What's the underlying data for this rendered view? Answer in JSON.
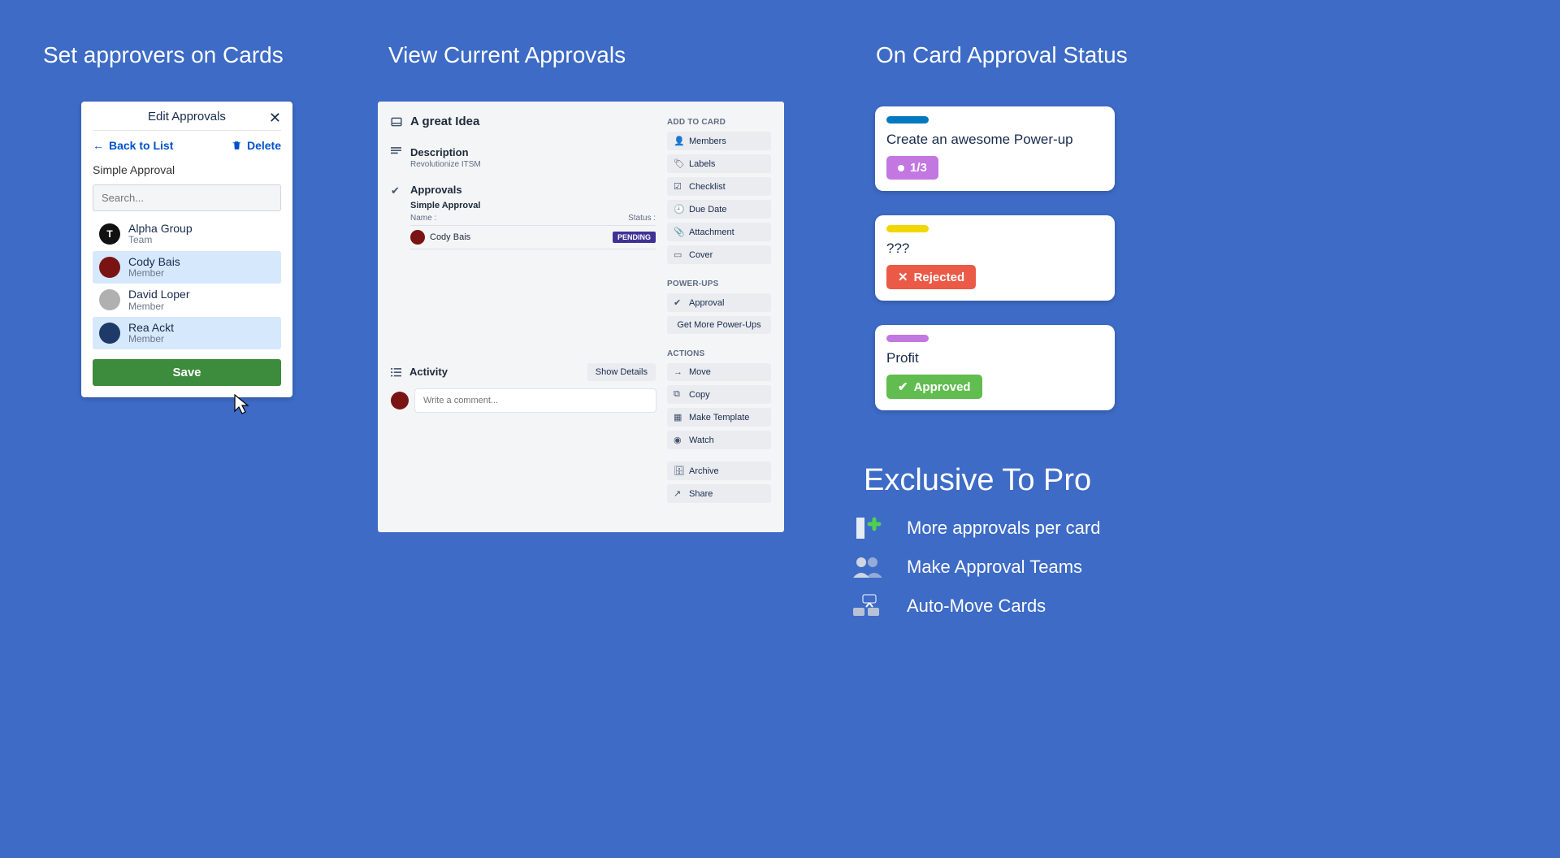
{
  "headings": {
    "col1": "Set approvers on Cards",
    "col2": "View Current Approvals",
    "col3": "On Card Approval Status"
  },
  "editPopover": {
    "title": "Edit Approvals",
    "back": "Back to List",
    "delete": "Delete",
    "sectionLabel": "Simple Approval",
    "searchPlaceholder": "Search...",
    "members": [
      {
        "name": "Alpha Group",
        "role": "Team",
        "initial": "T",
        "avatar": "black",
        "selected": false
      },
      {
        "name": "Cody Bais",
        "role": "Member",
        "initial": "",
        "avatar": "red",
        "selected": true
      },
      {
        "name": "David Loper",
        "role": "Member",
        "initial": "",
        "avatar": "grey",
        "selected": false
      },
      {
        "name": "Rea Ackt",
        "role": "Member",
        "initial": "",
        "avatar": "blue",
        "selected": true
      }
    ],
    "save": "Save"
  },
  "cardBack": {
    "title": "A great Idea",
    "description": {
      "label": "Description",
      "text": "Revolutionize ITSM"
    },
    "approvals": {
      "label": "Approvals",
      "subtitle": "Simple Approval",
      "headName": "Name :",
      "headStatus": "Status :",
      "row": {
        "name": "Cody Bais",
        "status": "PENDING"
      }
    },
    "activity": {
      "label": "Activity",
      "showDetails": "Show Details",
      "commentPlaceholder": "Write a comment..."
    },
    "side": {
      "addToCard": "ADD TO CARD",
      "members": "Members",
      "labels": "Labels",
      "checklist": "Checklist",
      "dueDate": "Due Date",
      "attachment": "Attachment",
      "cover": "Cover",
      "powerUps": "POWER-UPS",
      "approval": "Approval",
      "getMore": "Get More Power-Ups",
      "actions": "ACTIONS",
      "move": "Move",
      "copy": "Copy",
      "makeTemplate": "Make Template",
      "watch": "Watch",
      "archive": "Archive",
      "share": "Share"
    }
  },
  "statusCards": [
    {
      "labelColor": "#0079bf",
      "title": "Create an awesome Power-up",
      "badgeClass": "purple",
      "badgeIcon": "dot",
      "badgeText": "1/3"
    },
    {
      "labelColor": "#f2d600",
      "title": "???",
      "badgeClass": "red",
      "badgeIcon": "x",
      "badgeText": "Rejected"
    },
    {
      "labelColor": "#c377e0",
      "title": "Profit",
      "badgeClass": "green",
      "badgeIcon": "check",
      "badgeText": "Approved"
    }
  ],
  "pro": {
    "heading": "Exclusive To Pro",
    "items": [
      "More approvals per card",
      "Make Approval Teams",
      "Auto-Move Cards"
    ]
  }
}
